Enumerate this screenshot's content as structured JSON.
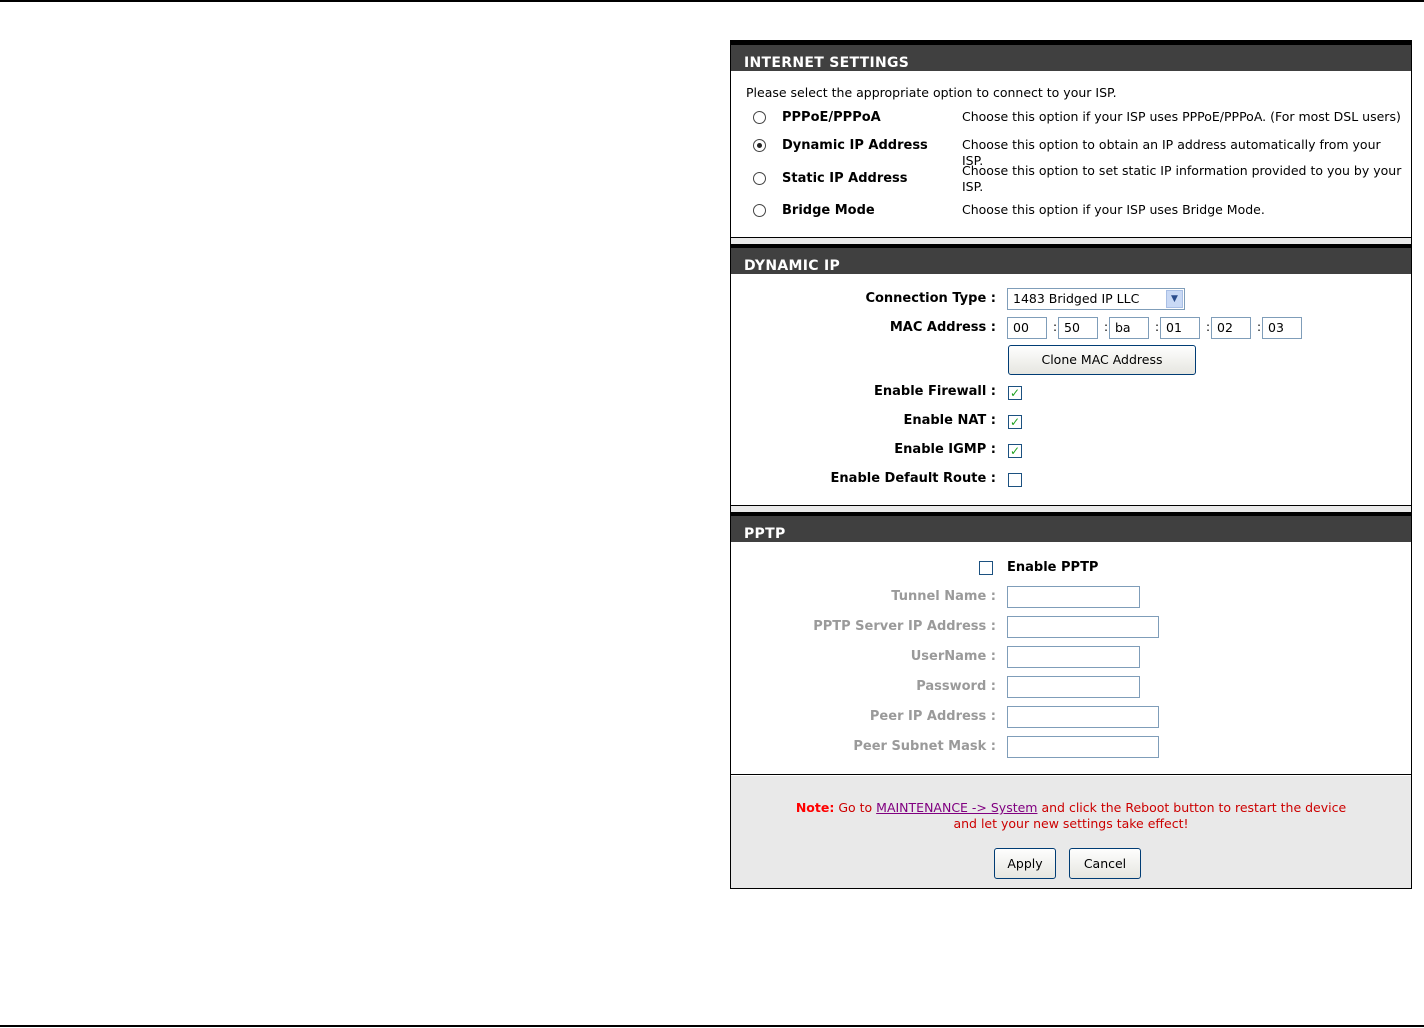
{
  "internet_settings": {
    "title": "INTERNET SETTINGS",
    "intro": "Please select the appropriate option to connect to your ISP.",
    "options": [
      {
        "label": "PPPoE/PPPoA",
        "desc": "Choose this option if your ISP uses PPPoE/PPPoA. (For most DSL users)",
        "selected": false
      },
      {
        "label": "Dynamic IP Address",
        "desc": "Choose this option to obtain an IP address automatically from your ISP.",
        "selected": true
      },
      {
        "label": "Static IP Address",
        "desc": "Choose this option to set static IP information provided to you by your ISP.",
        "selected": false
      },
      {
        "label": "Bridge Mode",
        "desc": "Choose this option if your ISP uses Bridge Mode.",
        "selected": false
      }
    ]
  },
  "dynamic_ip": {
    "title": "DYNAMIC IP",
    "connection_type_label": "Connection Type :",
    "connection_type_value": "1483 Bridged IP LLC",
    "mac_label": "MAC Address :",
    "mac": [
      "00",
      "50",
      "ba",
      "01",
      "02",
      "03"
    ],
    "mac_separator": ":",
    "clone_button": "Clone MAC Address",
    "firewall_label": "Enable Firewall :",
    "nat_label": "Enable NAT :",
    "igmp_label": "Enable IGMP :",
    "default_route_label": "Enable Default Route :",
    "firewall_checked": true,
    "nat_checked": true,
    "igmp_checked": true,
    "default_route_checked": false
  },
  "pptp": {
    "title": "PPTP",
    "enable_label": "Enable PPTP",
    "enable_checked": false,
    "tunnel_name_label": "Tunnel Name :",
    "server_ip_label": "PPTP Server IP Address :",
    "username_label": "UserName :",
    "password_label": "Password :",
    "peer_ip_label": "Peer IP Address :",
    "peer_mask_label": "Peer Subnet Mask :"
  },
  "footer": {
    "note_prefix": "Note:",
    "note_go": " Go to ",
    "note_link": "MAINTENANCE -> System",
    "note_rest1": " and click the Reboot button to restart the device",
    "note_rest2": "and let your new settings take effect!",
    "apply_button": "Apply",
    "cancel_button": "Cancel"
  },
  "check_glyph": "✓",
  "dropdown_glyph": "▼"
}
